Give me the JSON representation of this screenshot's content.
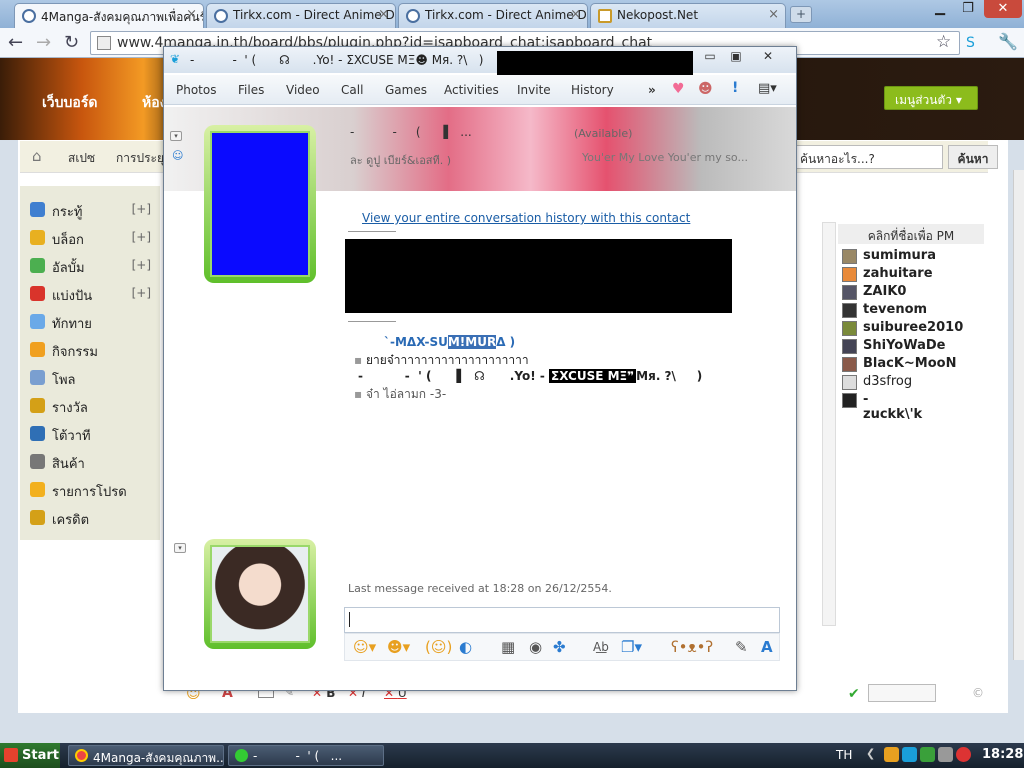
{
  "browser": {
    "tabs": [
      {
        "label": "4Manga-สังคมคุณภาพเพื่อคนรัก",
        "active": true
      },
      {
        "label": "Tirkx.com - Direct Anime Down",
        "active": false
      },
      {
        "label": "Tirkx.com - Direct Anime Down",
        "active": false
      },
      {
        "label": "Nekopost.Net",
        "active": false
      }
    ],
    "url": "www.4manga.in.th/board/bbs/plugin.php?id=jsapboard_chat:jsapboard_chat"
  },
  "site": {
    "banner_title": "เว็บบอร์ด",
    "banner_title2": "ห้อง",
    "member_menu": "เมนูส่วนตัว",
    "breadcrumb": [
      "สเปซ",
      "การประยุก"
    ],
    "search_placeholder": "ค้นหาอะไร...?",
    "search_button": "ค้นหา",
    "sidebar": [
      {
        "label": "กระทู้",
        "plus": "[+]",
        "color": "#3f7fd0"
      },
      {
        "label": "บล็อก",
        "plus": "[+]",
        "color": "#e8b020"
      },
      {
        "label": "อัลบั้ม",
        "plus": "[+]",
        "color": "#4caf50"
      },
      {
        "label": "แบ่งปัน",
        "plus": "[+]",
        "color": "#d9342b"
      },
      {
        "label": "ทักทาย",
        "plus": "",
        "color": "#6aa9e8"
      },
      {
        "label": "กิจกรรม",
        "plus": "",
        "color": "#f0a020"
      },
      {
        "label": "โพล",
        "plus": "",
        "color": "#7a9fd0"
      },
      {
        "label": "รางวัล",
        "plus": "",
        "color": "#d4a017"
      },
      {
        "label": "โต้วาที",
        "plus": "",
        "color": "#2f6fb5"
      },
      {
        "label": "สินค้า",
        "plus": "",
        "color": "#777777"
      },
      {
        "label": "รายการโปรด",
        "plus": "",
        "color": "#f2b01e"
      },
      {
        "label": "เครดิต",
        "plus": "",
        "color": "#d4a017"
      }
    ],
    "pm_header": "คลิกที่ชื่อเพื่อ PM",
    "pm_users": [
      "sumimura",
      "zahuitare",
      "ZAIK0",
      "tevenom",
      "suiburee2010",
      "ShiYoWaDe",
      "BlacK~MooN",
      "d3sfrog",
      "-zuckk\\'k"
    ],
    "compose_labels": [
      "B",
      "I",
      "U"
    ]
  },
  "skype": {
    "title": "-          -  ' (      ☊      .Yo! - ΣXCUSE MΞ☻ Mя. ?\\   )",
    "menu": [
      "Photos",
      "Files",
      "Video",
      "Call",
      "Games",
      "Activities",
      "Invite",
      "History",
      "»"
    ],
    "status": "(Available)",
    "header_line1": "-          -     (      ▌  ...",
    "header_mood": "ละ ดูปู เบียร์&เอสที. )",
    "header_song": "You'er My Love You'er my so...",
    "history_link": "View your entire conversation history with this contact",
    "messages": [
      {
        "name_prefix": "`-MΔX-SU",
        "name_highlight": "M!MUR",
        "name_suffix": "Δ )",
        "text": "ยายจ๋าาาาาาาาาาาาาาาาาาาา"
      },
      {
        "sender": "-          -  ' (      ▌  ☊      .Yo! -",
        "sender_highlight": "ΣXCUSE MΞ❞",
        "sender_suffix": "Mя. ?\\     )",
        "text": "จ๋า ไอ่ลามก -3-"
      }
    ],
    "last_message": "Last message received at 18:28 on 26/12/2554."
  },
  "taskbar": {
    "start": "Start",
    "tasks": [
      "4Manga-สังคมคุณภาพ...",
      "-          -  ' (   ..."
    ],
    "language": "TH",
    "time": "18:28",
    "ampm": "PM"
  }
}
